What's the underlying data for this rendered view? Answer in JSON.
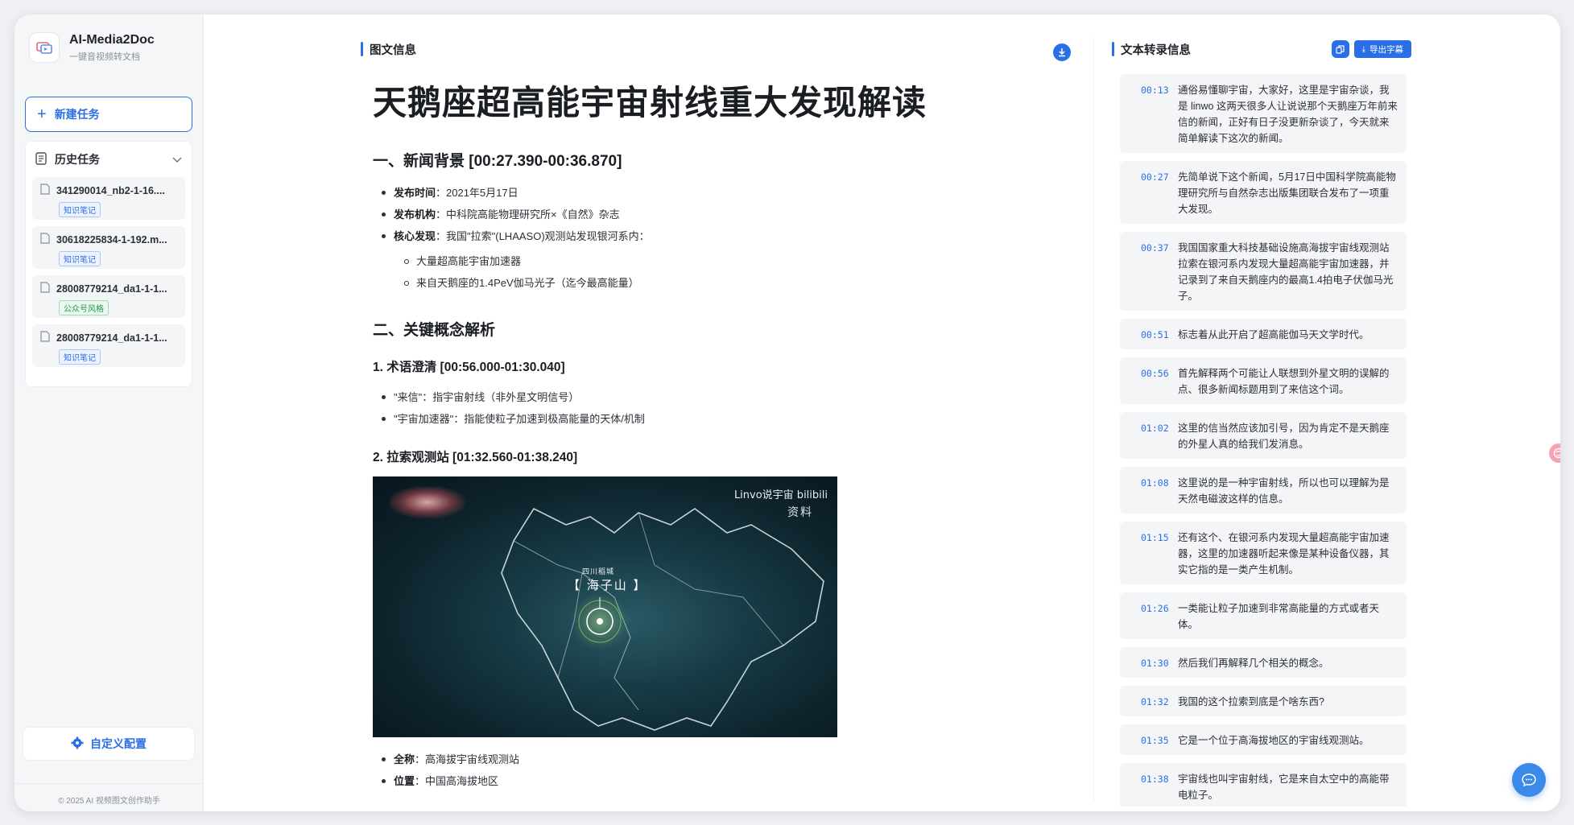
{
  "app": {
    "title": "AI-Media2Doc",
    "subtitle": "一键音视频转文档"
  },
  "sidebar": {
    "new_task_label": "新建任务",
    "history_label": "历史任务",
    "history_items": [
      {
        "name": "341290014_nb2-1-16....",
        "tag": "知识笔记",
        "tag_color": "#2b6fe6"
      },
      {
        "name": "30618225834-1-192.m...",
        "tag": "知识笔记",
        "tag_color": "#2b6fe6"
      },
      {
        "name": "28008779214_da1-1-1...",
        "tag": "公众号风格",
        "tag_color": "#1f9d4a"
      },
      {
        "name": "28008779214_da1-1-1...",
        "tag": "知识笔记",
        "tag_color": "#2b6fe6"
      }
    ],
    "config_label": "自定义配置",
    "footer": "© 2025 AI 视频图文创作助手"
  },
  "article": {
    "section_label": "图文信息",
    "title": "天鹅座超高能宇宙射线重大发现解读",
    "h2_background": "一、新闻背景 [00:27.390-00:36.870]",
    "background_items": [
      {
        "key": "发布时间",
        "val": "：2021年5月17日"
      },
      {
        "key": "发布机构",
        "val": "：中科院高能物理研究所×《自然》杂志"
      },
      {
        "key": "核心发现",
        "val": "：我国\"拉索\"(LHAASO)观测站发现银河系内："
      }
    ],
    "discoveries": [
      "大量超高能宇宙加速器",
      "来自天鹅座的1.4PeV伽马光子（迄今最高能量）"
    ],
    "h2_concepts": "二、关键概念解析",
    "h3_terms": "1. 术语澄清 [00:56.000-01:30.040]",
    "terms": [
      "\"来信\"：指宇宙射线（非外星文明信号）",
      "\"宇宙加速器\"：指能使粒子加速到极高能量的天体/机制"
    ],
    "h3_lhaaso": "2. 拉索观测站 [01:32.560-01:38.240]",
    "image": {
      "watermark": "Linvo说宇宙 bilibili",
      "watermark2": "资料",
      "loc_small": "四川稻城",
      "loc": "【 海子山 】"
    },
    "lhaaso_items": [
      {
        "key": "全称",
        "val": "：高海拔宇宙线观测站"
      },
      {
        "key": "位置",
        "val": "：中国高海拔地区"
      }
    ]
  },
  "transcript": {
    "section_label": "文本转录信息",
    "export_label": "导出字幕",
    "segments": [
      {
        "time": "00:13",
        "text": "通俗易懂聊宇宙，大家好，这里是宇宙杂谈，我是 linwo 这两天很多人让说说那个天鹅座万年前来信的新闻，正好有日子没更新杂谈了，今天就来简单解读下这次的新闻。"
      },
      {
        "time": "00:27",
        "text": "先简单说下这个新闻，5月17日中国科学院高能物理研究所与自然杂志出版集团联合发布了一项重大发现。"
      },
      {
        "time": "00:37",
        "text": "我国国家重大科技基础设施高海拔宇宙线观测站拉索在银河系内发现大量超高能宇宙加速器，并记录到了来自天鹅座内的最高1.4拍电子伏伽马光子。"
      },
      {
        "time": "00:51",
        "text": "标志着从此开启了超高能伽马天文学时代。"
      },
      {
        "time": "00:56",
        "text": "首先解释两个可能让人联想到外星文明的误解的点、很多新闻标题用到了来信这个词。"
      },
      {
        "time": "01:02",
        "text": "这里的信当然应该加引号，因为肯定不是天鹅座的外星人真的给我们发消息。"
      },
      {
        "time": "01:08",
        "text": "这里说的是一种宇宙射线，所以也可以理解为是天然电磁波这样的信息。"
      },
      {
        "time": "01:15",
        "text": "还有这个、在银河系内发现大量超高能宇宙加速器，这里的加速器听起来像是某种设备仪器，其实它指的是一类产生机制。"
      },
      {
        "time": "01:26",
        "text": "一类能让粒子加速到非常高能量的方式或者天体。"
      },
      {
        "time": "01:30",
        "text": "然后我们再解释几个相关的概念。"
      },
      {
        "time": "01:32",
        "text": "我国的这个拉索到底是个啥东西?"
      },
      {
        "time": "01:35",
        "text": "它是一个位于高海拔地区的宇宙线观测站。"
      },
      {
        "time": "01:38",
        "text": "宇宙线也叫宇宙射线，它是来自太空中的高能带电粒子。"
      }
    ]
  },
  "colors": {
    "accent": "#2b6fe6",
    "green": "#1f9d4a"
  }
}
